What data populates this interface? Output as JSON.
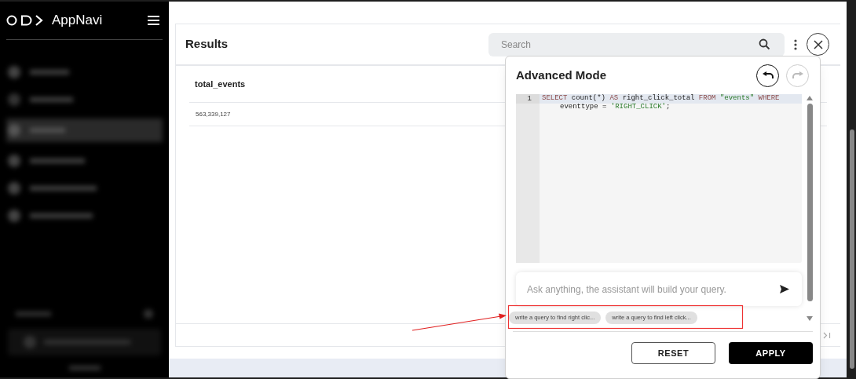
{
  "sidebar": {
    "brand": "AppNavi"
  },
  "results": {
    "title": "Results",
    "search": {
      "placeholder": "Search"
    },
    "table": {
      "columns": [
        "total_events"
      ],
      "rows": [
        [
          "563,339,127"
        ]
      ]
    }
  },
  "advanced_mode": {
    "title": "Advanced Mode",
    "undo": {
      "disabled": false
    },
    "redo": {
      "disabled": true
    },
    "editor": {
      "lines": [
        {
          "number": "1",
          "tokens": [
            {
              "kind": "keyword",
              "text": "SELECT"
            },
            {
              "kind": "plain",
              "text": " count(*) "
            },
            {
              "kind": "keyword",
              "text": "AS"
            },
            {
              "kind": "plain",
              "text": " right_click_total "
            },
            {
              "kind": "keyword",
              "text": "FROM "
            },
            {
              "kind": "string",
              "text": "\"events\" "
            },
            {
              "kind": "keyword",
              "text": "WHERE"
            },
            {
              "kind": "plain",
              "text": " eventtype = "
            },
            {
              "kind": "string",
              "text": "'RIGHT_CLICK'"
            },
            {
              "kind": "plain",
              "text": ";"
            }
          ]
        }
      ]
    },
    "assistant": {
      "placeholder": "Ask anything, the assistant will build your query."
    },
    "suggestions": [
      "write a query to find right clic...",
      "write a query to find left click..."
    ],
    "buttons": [
      {
        "kind": "outline",
        "label": "RESET"
      },
      {
        "kind": "solid",
        "label": "APPLY"
      }
    ]
  }
}
